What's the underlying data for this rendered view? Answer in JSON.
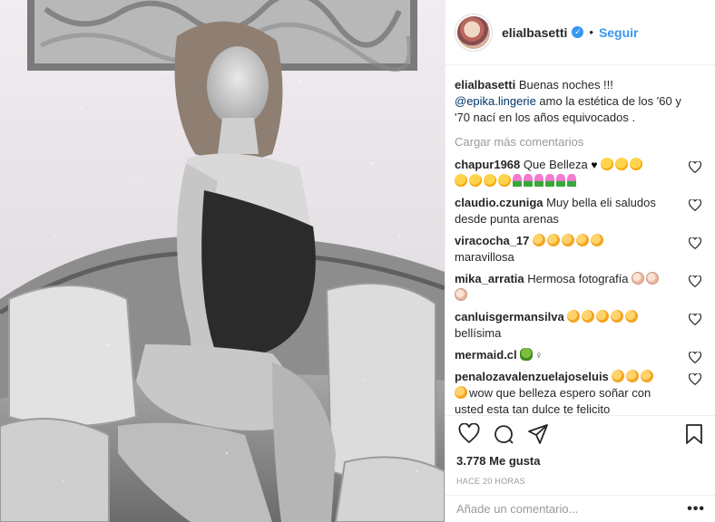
{
  "post": {
    "header": {
      "username": "elialbasetti",
      "verified": true,
      "separator": "•",
      "follow_label": "Seguir"
    },
    "caption": {
      "username": "elialbasetti",
      "text_before": " Buenas noches !!! ",
      "mention": "@epika.lingerie",
      "text_after": " amo la estética de los '60 y '70 nací en los años equivocados ."
    },
    "load_more_label": "Cargar más comentarios",
    "comments": [
      {
        "username": "chapur1968",
        "text": "Que Belleza"
      },
      {
        "username": "claudio.czuniga",
        "text": "Muy bella eli saludos desde punta arenas"
      },
      {
        "username": "viracocha_17",
        "text": "maravillosa"
      },
      {
        "username": "mika_arratia",
        "text": "Hermosa fotografía"
      },
      {
        "username": "canluisgermansilva",
        "text": "bellísima"
      },
      {
        "username": "mermaid.cl",
        "text": ""
      },
      {
        "username": "penalozavalenzuelajoseluis",
        "text": "wow que belleza espero soñar con usted esta tan dulce te felicito"
      }
    ],
    "likes_label": "3.778 Me gusta",
    "timestamp": "HACE 20 HORAS",
    "add_comment_placeholder": "Añade un comentario...",
    "more_options": "•••",
    "icons": {
      "like": "heart-icon",
      "comment": "comment-icon",
      "share": "share-icon",
      "save": "bookmark-icon"
    },
    "colors": {
      "link": "#3897f0",
      "mention": "#003569",
      "muted": "#999999",
      "text": "#262626",
      "border": "#efefef"
    }
  }
}
